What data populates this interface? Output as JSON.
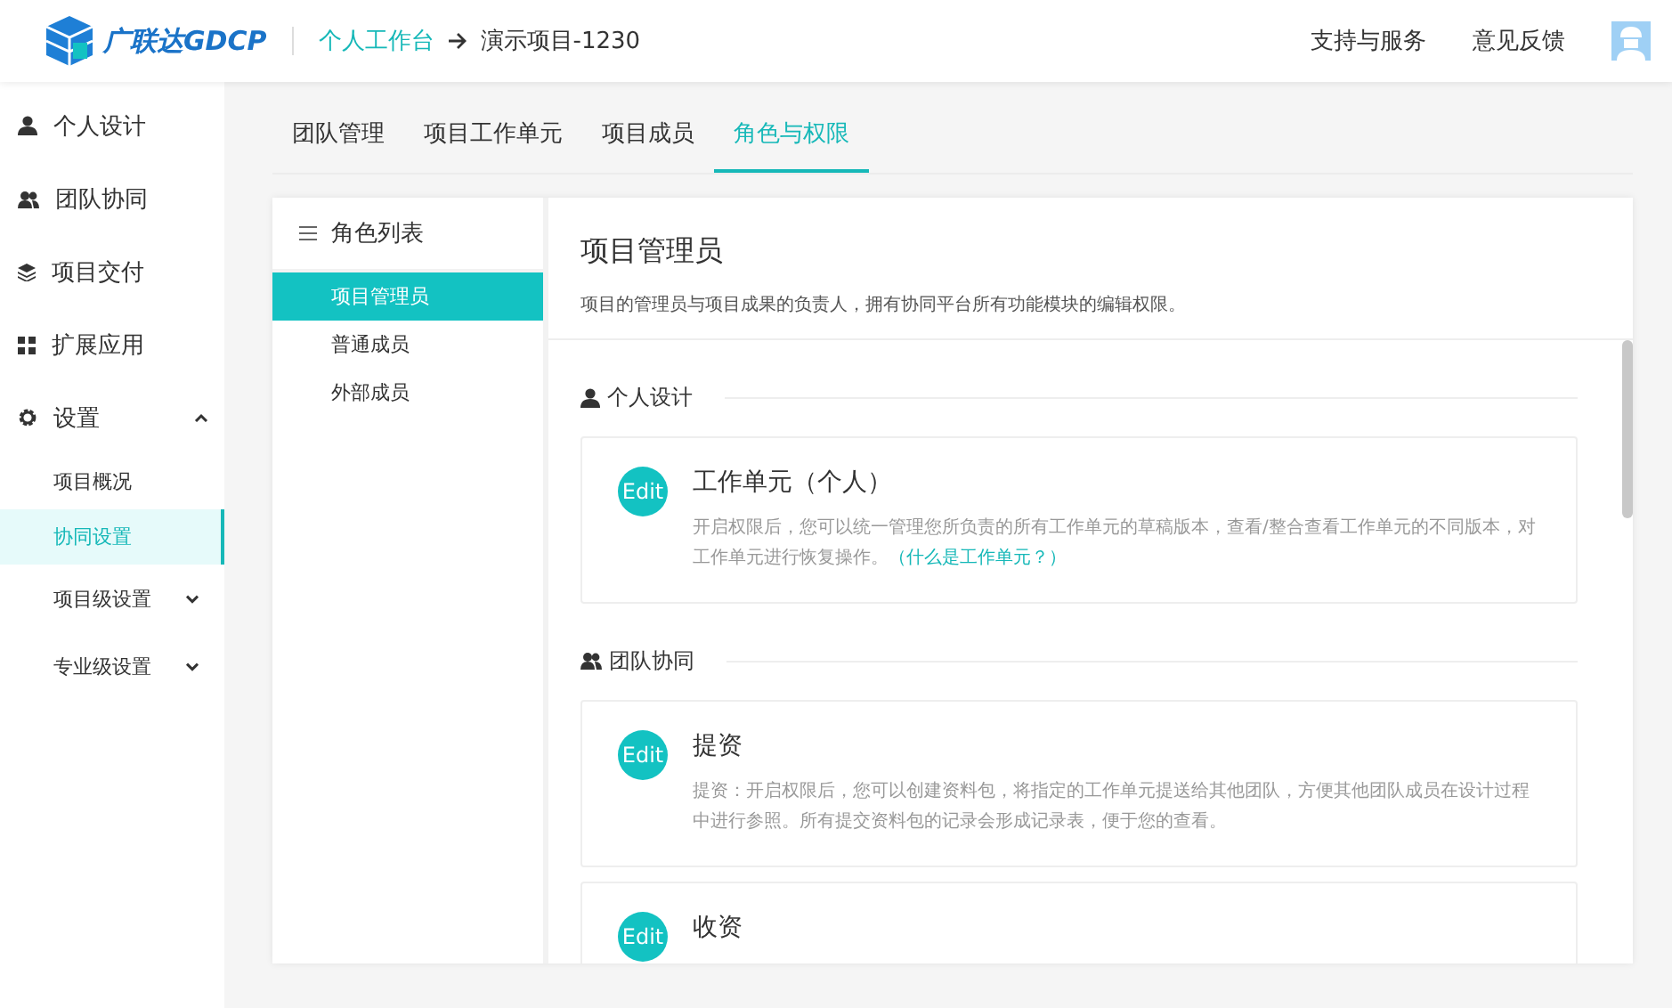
{
  "header": {
    "logo_text": "广联达GDCP",
    "breadcrumb": [
      {
        "label": "个人工作台",
        "link": true
      },
      {
        "label": "演示项目-1230",
        "link": false
      }
    ],
    "links": [
      "支持与服务",
      "意见反馈"
    ]
  },
  "sidebar": {
    "items": [
      {
        "label": "个人设计",
        "kind": "person",
        "selected": false
      },
      {
        "label": "团队协同",
        "kind": "team",
        "selected": false
      },
      {
        "label": "项目交付",
        "kind": "stack",
        "selected": false
      },
      {
        "label": "扩展应用",
        "kind": "grid",
        "selected": false
      },
      {
        "label": "设置",
        "kind": "gear",
        "selected": false,
        "expanded": true,
        "children": [
          {
            "label": "项目概况",
            "selected": false
          },
          {
            "label": "协同设置",
            "selected": true
          },
          {
            "label": "项目级设置",
            "selected": false,
            "expanded": false
          },
          {
            "label": "专业级设置",
            "selected": false,
            "expanded": false
          }
        ]
      }
    ]
  },
  "tabs": [
    {
      "label": "团队管理",
      "selected": false
    },
    {
      "label": "项目工作单元",
      "selected": false
    },
    {
      "label": "项目成员",
      "selected": false
    },
    {
      "label": "角色与权限",
      "selected": true
    }
  ],
  "role_list": {
    "title": "角色列表",
    "roles": [
      {
        "label": "项目管理员",
        "selected": true
      },
      {
        "label": "普通成员",
        "selected": false
      },
      {
        "label": "外部成员",
        "selected": false
      }
    ]
  },
  "role_detail": {
    "title": "项目管理员",
    "description": "项目的管理员与项目成果的负责人，拥有协同平台所有功能模块的编辑权限。",
    "sections": [
      {
        "title": "个人设计",
        "kind": "person",
        "permissions": [
          {
            "badge": "Edit",
            "title": "工作单元（个人）",
            "description": "开启权限后，您可以统一管理您所负责的所有工作单元的草稿版本，查看/整合查看工作单元的不同版本，对工作单元进行恢复操作。",
            "link": "（什么是工作单元？）"
          }
        ]
      },
      {
        "title": "团队协同",
        "kind": "team",
        "permissions": [
          {
            "badge": "Edit",
            "title": "提资",
            "description": "提资：开启权限后，您可以创建资料包，将指定的工作单元提送给其他团队，方便其他团队成员在设计过程中进行参照。所有提交资料包的记录会形成记录表，便于您的查看。"
          },
          {
            "badge": "Edit",
            "title": "收资"
          }
        ]
      }
    ]
  }
}
